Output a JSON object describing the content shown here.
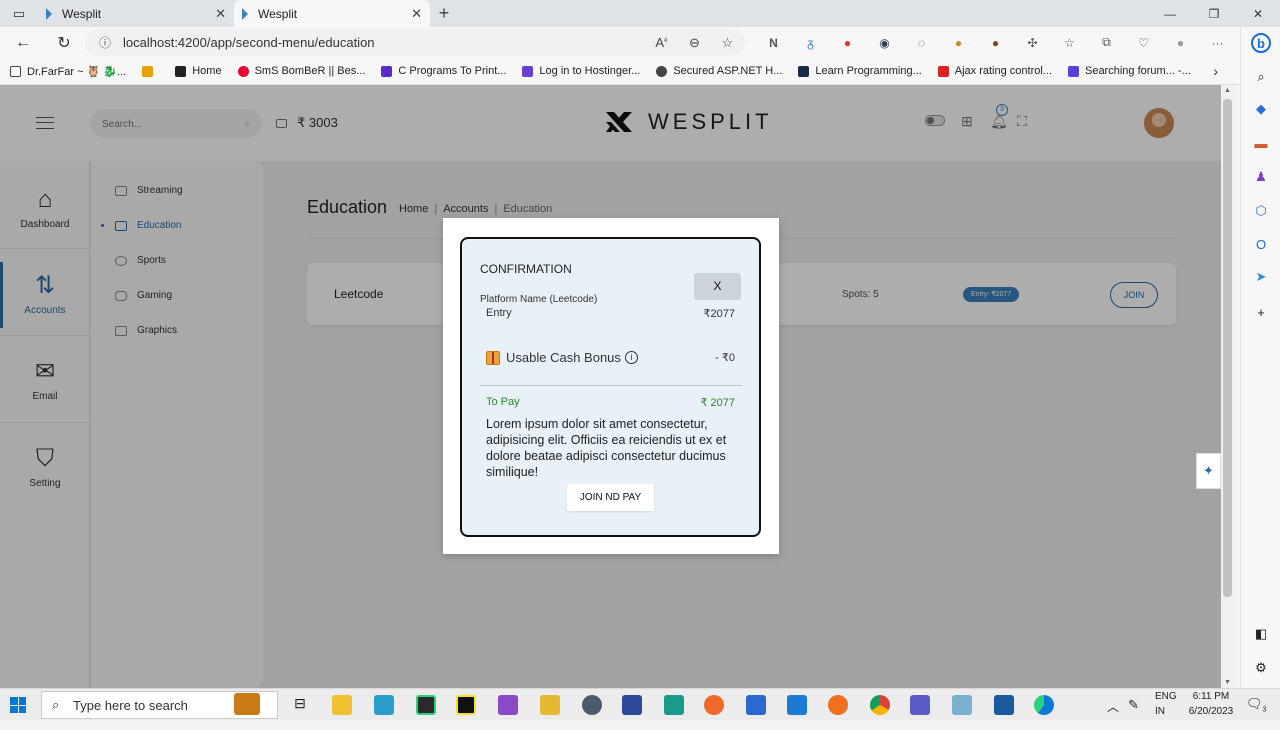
{
  "browser": {
    "tabs": [
      {
        "label": "Wesplit"
      },
      {
        "label": "Wesplit"
      }
    ],
    "url": "localhost:4200/app/second-menu/education",
    "bookmarks": [
      "Dr.FarFar ~ 🦉 🐉...",
      "",
      "Home",
      "SmS BomBeR || Bes...",
      "C Programs To Print...",
      "Log in to Hostinger...",
      "Secured ASP.NET H...",
      "Learn Programming...",
      "Ajax rating control...",
      "Searching forum... -..."
    ]
  },
  "header": {
    "search_placeholder": "Search...",
    "wallet": "₹ 3003",
    "logo_text": "WESPLIT",
    "notif_count": "3"
  },
  "nav": {
    "items": [
      {
        "label": "Dashboard",
        "icon": "store-icon"
      },
      {
        "label": "Accounts",
        "icon": "arrows-icon"
      },
      {
        "label": "Email",
        "icon": "mail-icon"
      },
      {
        "label": "Setting",
        "icon": "shield-icon"
      }
    ],
    "sub": [
      "Streaming",
      "Education",
      "Sports",
      "Gaming",
      "Graphics"
    ]
  },
  "page": {
    "title": "Education",
    "crumbs": [
      "Home",
      "Accounts",
      "Education"
    ]
  },
  "card": {
    "name": "Leetcode",
    "spots": "Spots: 5",
    "entry": "Entry: ₹2077",
    "join": "JOIN"
  },
  "modal": {
    "title": "CONFIRMATION",
    "close": "X",
    "platform": "Platform Name (Leetcode)",
    "entry_label": "Entry",
    "entry_value": "₹2077",
    "bonus_label": "Usable Cash Bonus",
    "bonus_value": "- ₹0",
    "pay_label": "To Pay",
    "pay_value": "₹ 2077",
    "lorem": "Lorem ipsum dolor sit amet consectetur, adipisicing elit. Officiis ea reiciendis ut ex et dolore beatae adipisci consectetur ducimus similique!",
    "button": "JOIN ND PAY"
  },
  "taskbar": {
    "search": "Type here to search",
    "lang1": "ENG",
    "lang2": "IN",
    "time": "6:11 PM",
    "date": "6/20/2023",
    "notif": "3"
  },
  "colors": {
    "accent": "#2a6aa8",
    "pay": "#2d8a2d",
    "entry_badge": "#3a7fbf"
  }
}
